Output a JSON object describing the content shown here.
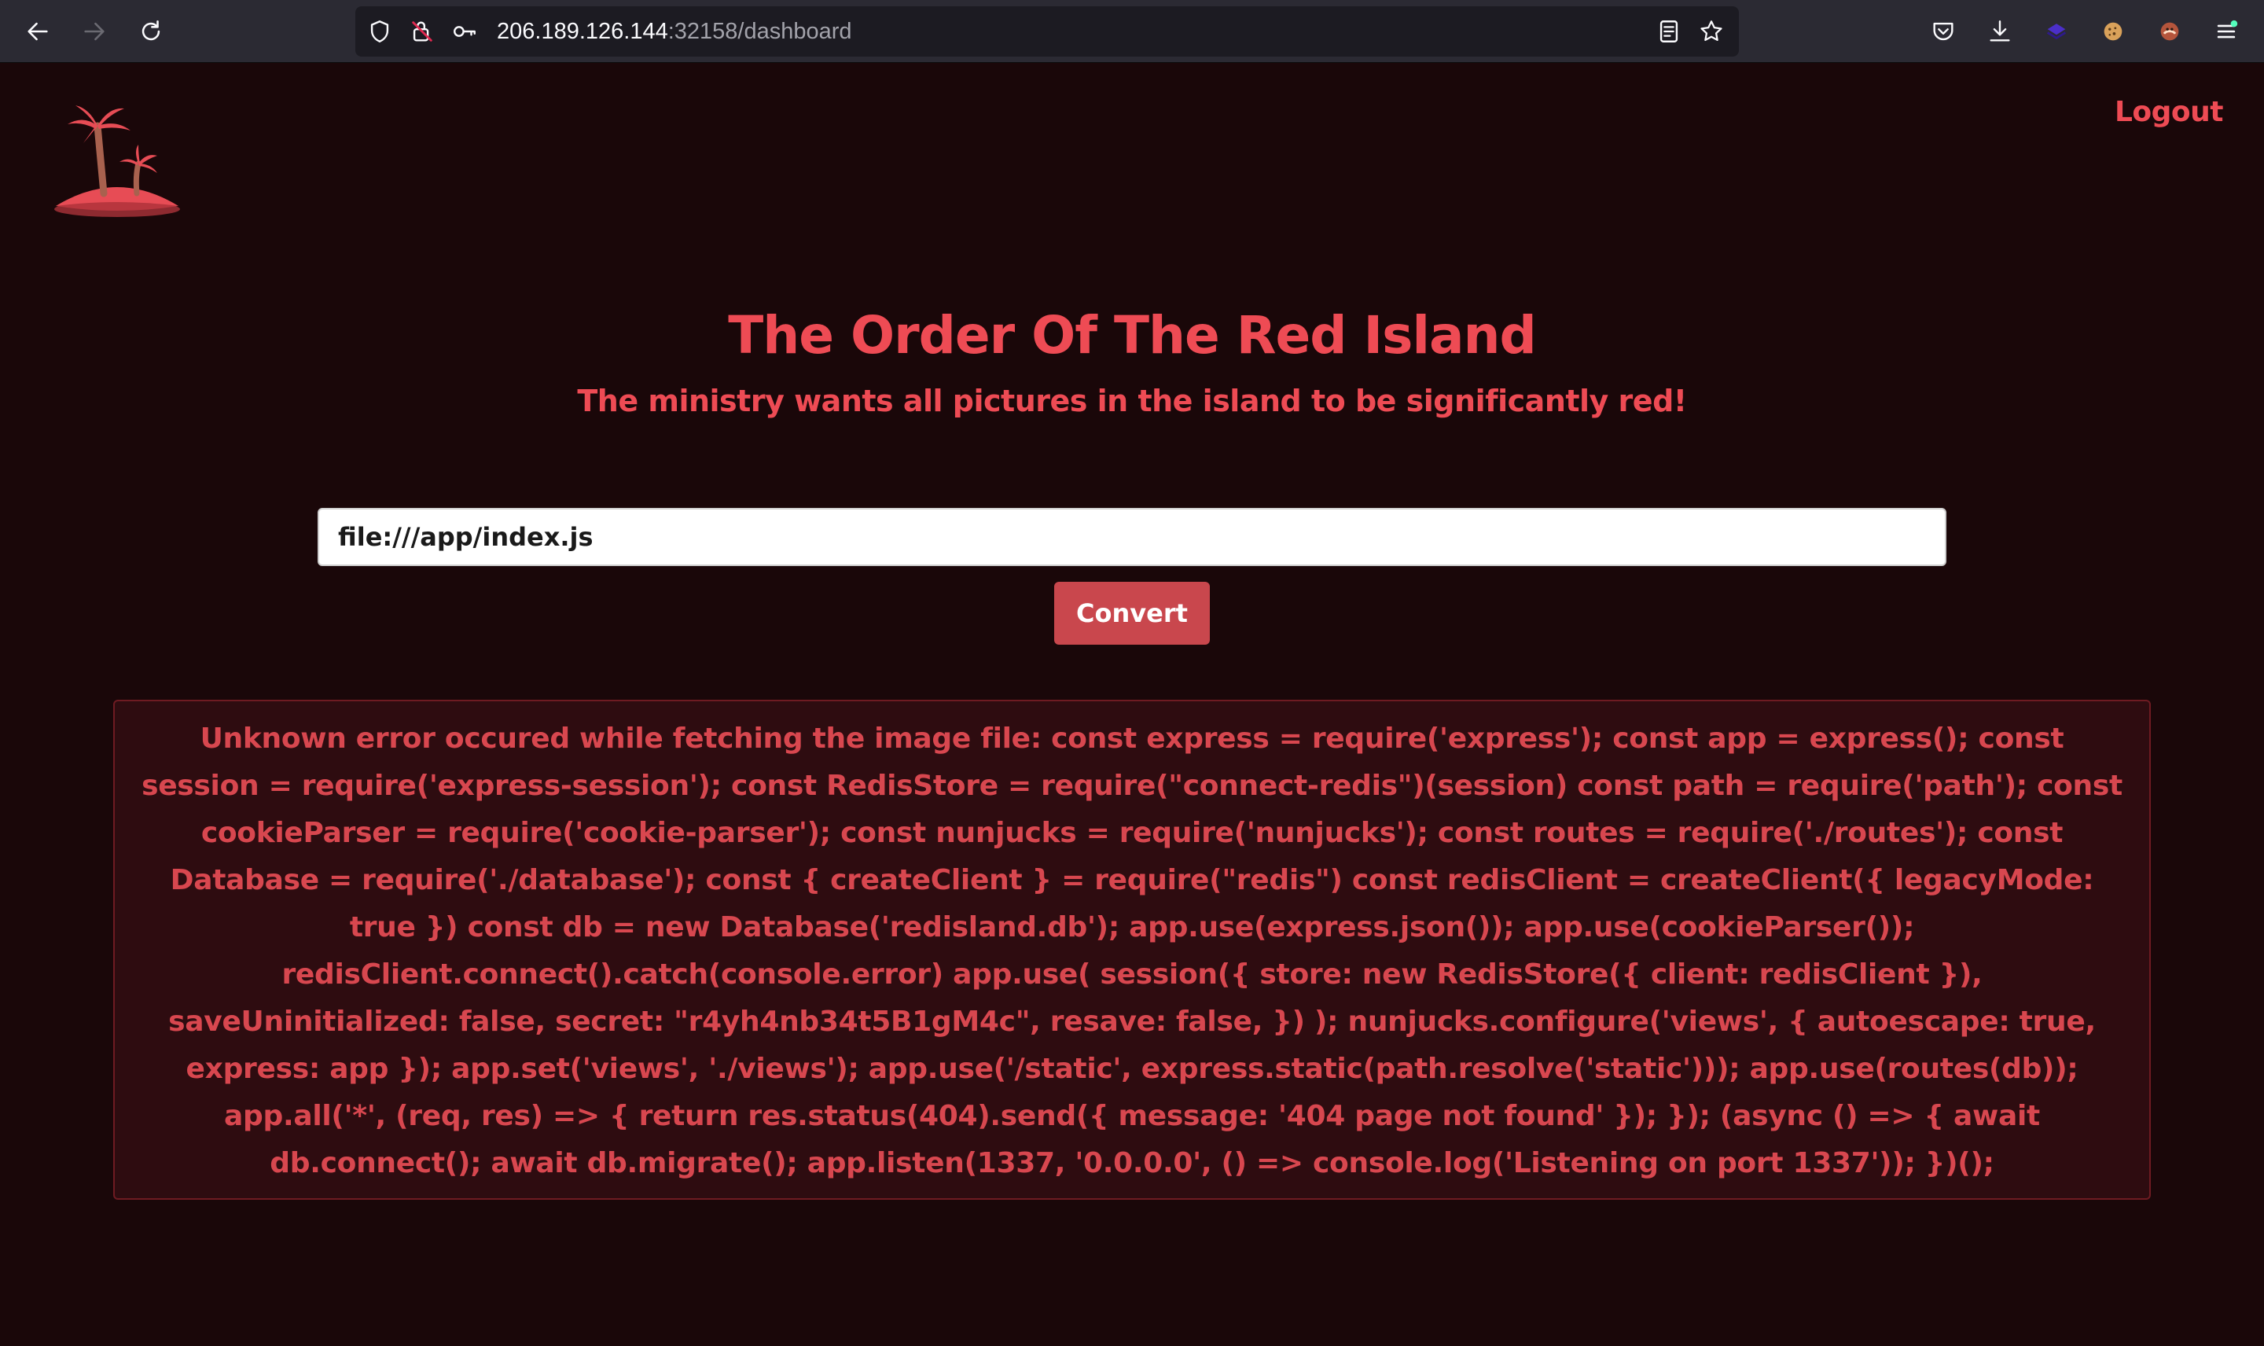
{
  "browser": {
    "url_host": "206.189.126.144",
    "url_rest": ":32158/dashboard",
    "icons": [
      "back-arrow-icon",
      "forward-arrow-icon",
      "reload-icon",
      "shield-icon",
      "insecure-lock-icon",
      "key-icon",
      "reader-view-icon",
      "bookmark-star-icon",
      "pocket-icon",
      "download-icon",
      "extension-icon",
      "cookie-extension-icon",
      "avatar-extension-icon",
      "menu-icon"
    ]
  },
  "header": {
    "logo_icon": "palm-island-icon",
    "logout_label": "Logout"
  },
  "main": {
    "title": "The Order Of The Red Island",
    "subtitle": "The ministry wants all pictures in the island to be significantly red!",
    "url_input_value": "file:///app/index.js",
    "convert_label": "Convert",
    "error_message": "Unknown error occured while fetching the image file: const express = require('express'); const app = express(); const session = require('express-session'); const RedisStore = require(\"connect-redis\")(session) const path = require('path'); const cookieParser = require('cookie-parser'); const nunjucks = require('nunjucks'); const routes = require('./routes'); const Database = require('./database'); const { createClient } = require(\"redis\") const redisClient = createClient({ legacyMode: true }) const db = new Database('redisland.db'); app.use(express.json()); app.use(cookieParser()); redisClient.connect().catch(console.error) app.use( session({ store: new RedisStore({ client: redisClient }), saveUninitialized: false, secret: \"r4yh4nb34t5B1gM4c\", resave: false, }) ); nunjucks.configure('views', { autoescape: true, express: app }); app.set('views', './views'); app.use('/static', express.static(path.resolve('static'))); app.use(routes(db)); app.all('*', (req, res) => { return res.status(404).send({ message: '404 page not found' }); }); (async () => { await db.connect(); await db.migrate(); app.listen(1337, '0.0.0.0', () => console.log('Listening on port 1337')); })();"
  },
  "colors": {
    "page_background": "#1a0709",
    "accent_red": "#ee4b54",
    "button_red": "#c9474d",
    "error_box_bg": "#2e0c10",
    "error_text": "#d8474f"
  }
}
